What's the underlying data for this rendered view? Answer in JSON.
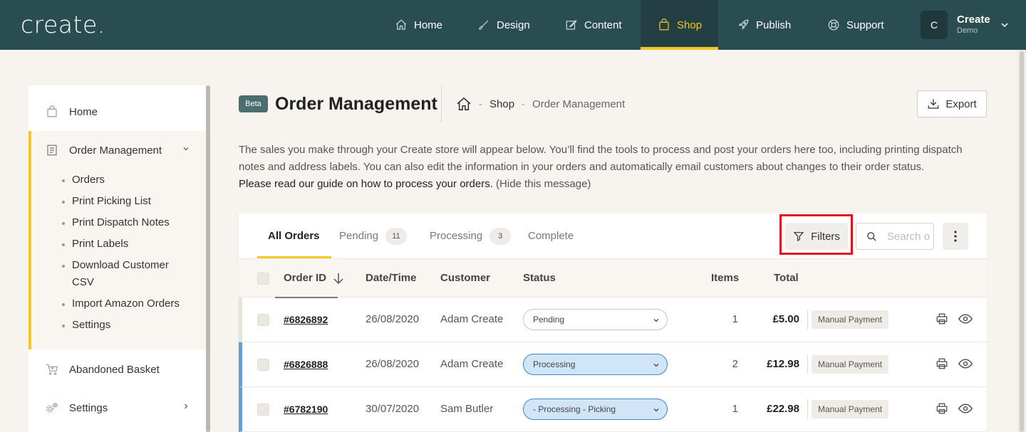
{
  "brand": {
    "logo": "create.",
    "accent": "#f3c623",
    "topbar_bg": "#2a4d52",
    "status_blue": "#5ba0d8"
  },
  "nav": [
    {
      "label": "Home",
      "icon": "home-icon",
      "active": false
    },
    {
      "label": "Design",
      "icon": "brush-icon",
      "active": false
    },
    {
      "label": "Content",
      "icon": "edit-icon",
      "active": false
    },
    {
      "label": "Shop",
      "icon": "shopping-bag-icon",
      "active": true
    },
    {
      "label": "Publish",
      "icon": "rocket-icon",
      "active": false
    },
    {
      "label": "Support",
      "icon": "lifebuoy-icon",
      "active": false
    }
  ],
  "account": {
    "initial": "C",
    "name": "Create",
    "plan": "Demo"
  },
  "sidebar": {
    "home": "Home",
    "order_management": "Order Management",
    "sub_items": [
      "Orders",
      "Print Picking List",
      "Print Dispatch Notes",
      "Print Labels",
      "Download Customer CSV",
      "Import Amazon Orders",
      "Settings"
    ],
    "abandoned_basket": "Abandoned Basket",
    "settings": "Settings"
  },
  "header": {
    "badge": "Beta",
    "title": "Order Management",
    "breadcrumb": {
      "sep": "-",
      "shop": "Shop",
      "current": "Order Management"
    },
    "export": "Export"
  },
  "intro": {
    "line1": "The sales you make through your Create store will appear below. You’ll find the tools to process and post your orders here too, including printing dispatch",
    "line2": "notes and address labels. You can also edit the information in your orders and automatically email customers about changes to their order status.",
    "guide": "Please read our guide on how to process your orders.",
    "hide": "(Hide this message)"
  },
  "tabs": [
    {
      "label": "All Orders",
      "count": null,
      "active": true
    },
    {
      "label": "Pending",
      "count": "11",
      "active": false
    },
    {
      "label": "Processing",
      "count": "3",
      "active": false
    },
    {
      "label": "Complete",
      "count": null,
      "active": false
    }
  ],
  "toolbar": {
    "filters": "Filters",
    "search_placeholder": "Search orders"
  },
  "table": {
    "columns": [
      "Order ID",
      "Date/Time",
      "Customer",
      "Status",
      "Items",
      "Total"
    ],
    "rows": [
      {
        "id": "#6826892",
        "date": "26/08/2020",
        "customer": "Adam Create",
        "status": "Pending",
        "items": "1",
        "total": "£5.00",
        "payment": "Manual Payment"
      },
      {
        "id": "#6826888",
        "date": "26/08/2020",
        "customer": "Adam Create",
        "status": "Processing",
        "items": "2",
        "total": "£12.98",
        "payment": "Manual Payment"
      },
      {
        "id": "#6782190",
        "date": "30/07/2020",
        "customer": "Sam Butler",
        "status": "- Processing - Picking",
        "items": "1",
        "total": "£22.98",
        "payment": "Manual Payment"
      }
    ]
  }
}
